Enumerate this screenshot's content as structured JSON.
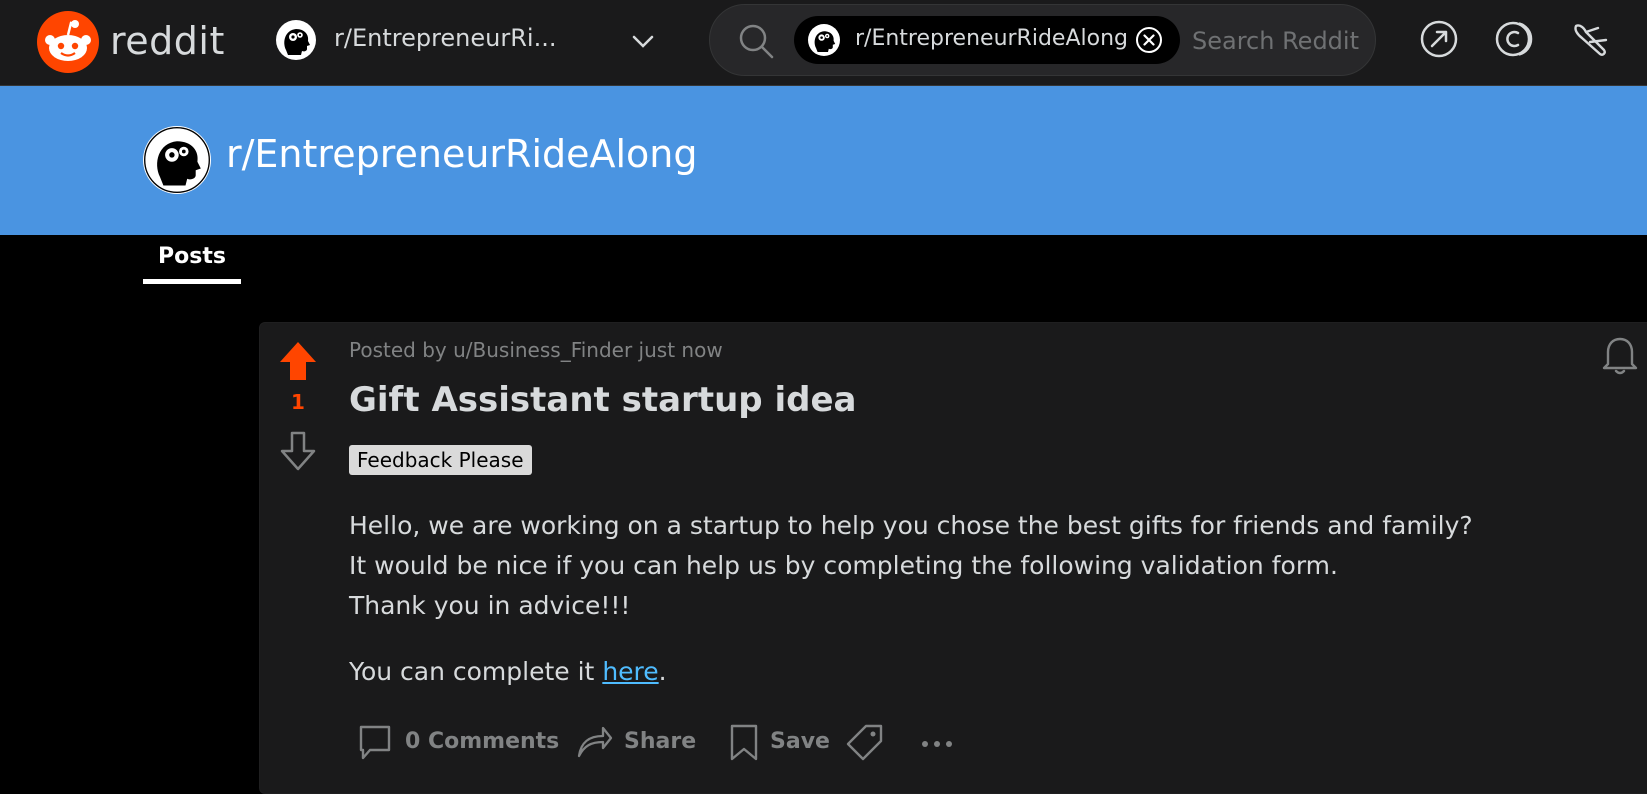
{
  "header": {
    "brand": "reddit",
    "community_switcher": "r/EntrepreneurRi...",
    "search": {
      "chip_label": "r/EntrepreneurRideAlong",
      "placeholder": "Search Reddit"
    }
  },
  "banner": {
    "community_name": "r/EntrepreneurRideAlong"
  },
  "tabs": [
    {
      "label": "Posts",
      "active": true
    }
  ],
  "post": {
    "votes": "1",
    "meta": "Posted by u/Business_Finder just now",
    "title": "Gift Assistant startup idea",
    "flair": "Feedback Please",
    "body": {
      "line1": "Hello, we are working on a startup to help you chose the best gifts for friends and family?",
      "line2": "It would be nice if you can help us by completing the following validation form.",
      "line3": "Thank you in advice!!!",
      "line4_prefix": "You can complete it ",
      "line4_link": "here",
      "line4_suffix": "."
    },
    "actions": {
      "comments": "0 Comments",
      "share": "Share",
      "save": "Save"
    }
  },
  "colors": {
    "header_bg": "#1a1a1b",
    "banner_bg": "#4a94e1",
    "upvote": "#ff4500",
    "link": "#4fbcff",
    "card_bg": "#1a1a1b"
  },
  "icons": [
    "reddit-logo",
    "community-avatar",
    "chevron-down-icon",
    "search-icon",
    "clear-icon",
    "popular-icon",
    "coins-icon",
    "all-icon",
    "upvote-icon",
    "downvote-icon",
    "bell-icon",
    "comment-icon",
    "share-icon",
    "bookmark-icon",
    "tag-icon",
    "more-icon"
  ]
}
